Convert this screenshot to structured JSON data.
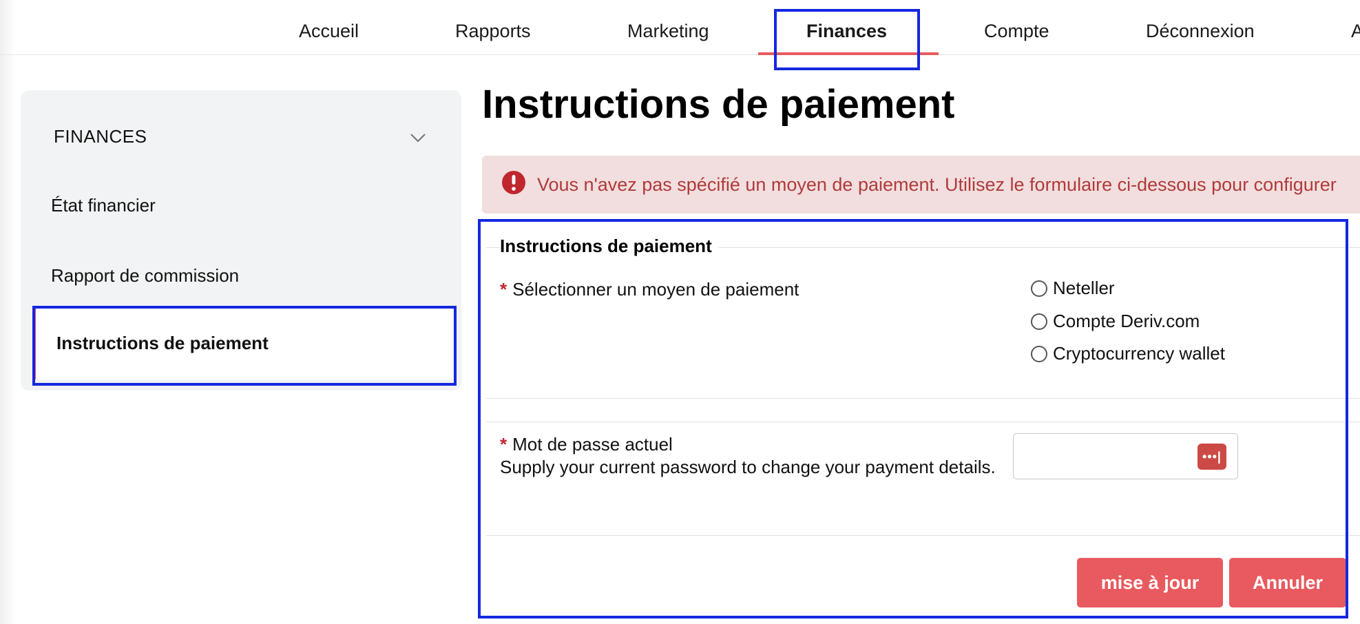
{
  "nav": {
    "items": [
      "Accueil",
      "Rapports",
      "Marketing",
      "Finances",
      "Compte",
      "Déconnexion",
      "A"
    ],
    "active": "Finances"
  },
  "sidebar": {
    "heading": "FINANCES",
    "items": [
      "État financier",
      "Rapport de commission",
      "Instructions de paiement"
    ]
  },
  "main": {
    "title": "Instructions de paiement",
    "alert": "Vous n'avez pas spécifié un moyen de paiement. Utilisez le formulaire ci-dessous pour configurer",
    "form": {
      "legend": "Instructions de paiement",
      "required_mark": "*",
      "method_label": "Sélectionner un moyen de paiement",
      "methods": [
        "Neteller",
        "Compte Deriv.com",
        "Cryptocurrency wallet"
      ],
      "password_label": "Mot de passe actuel",
      "password_help": "Supply your current password to change your payment details.",
      "password_icon_text": "•••|",
      "update_button": "mise à jour",
      "cancel_button": "Annuler"
    }
  },
  "colors": {
    "accent": "#e85a5f",
    "alert_bg": "#f2dede",
    "alert_text": "#b03a3a",
    "highlight": "#1428e0"
  }
}
